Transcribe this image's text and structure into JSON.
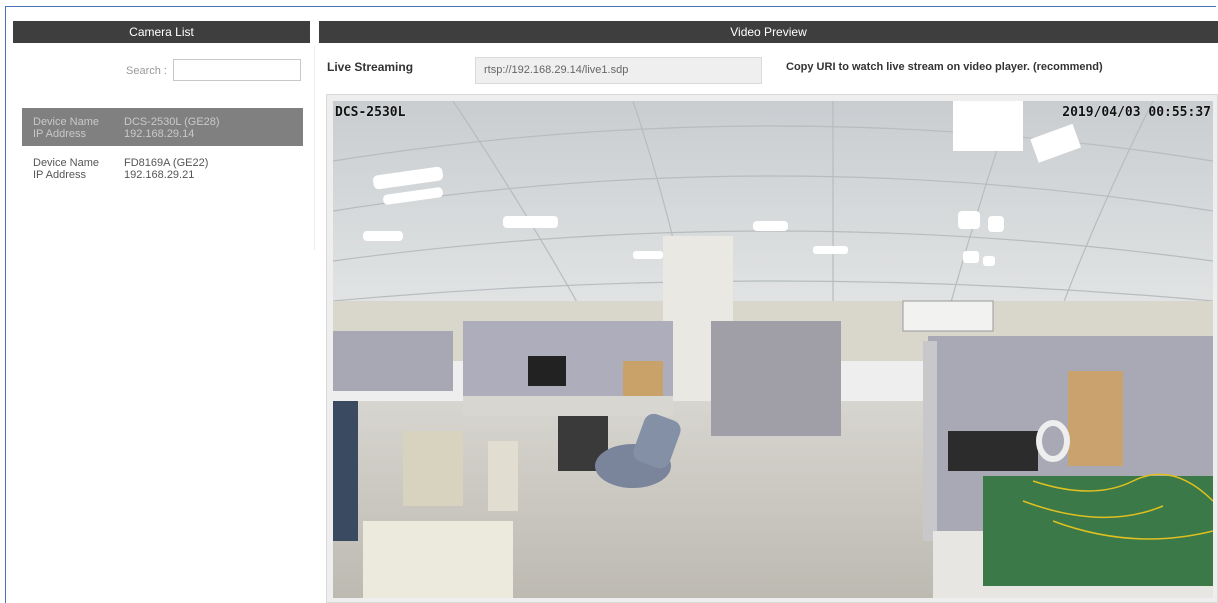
{
  "camera_list": {
    "title": "Camera List",
    "search_label": "Search :",
    "search_value": "",
    "devices": [
      {
        "name_label": "Device Name",
        "name": "DCS-2530L (GE28)",
        "ip_label": "IP Address",
        "ip": "192.168.29.14",
        "selected": true
      },
      {
        "name_label": "Device Name",
        "name": "FD8169A (GE22)",
        "ip_label": "IP Address",
        "ip": "192.168.29.21",
        "selected": false
      }
    ]
  },
  "video_preview": {
    "title": "Video Preview",
    "live_label": "Live Streaming",
    "uri": "rtsp://192.168.29.14/live1.sdp",
    "hint": "Copy URI to watch live stream on video player. (recommend)",
    "overlay_camera": "DCS-2530L",
    "overlay_timestamp": "2019/04/03 00:55:37"
  },
  "colors": {
    "header_bg": "#3e3e3e",
    "selected_row": "#808080",
    "frame_border": "#4a72b8"
  }
}
